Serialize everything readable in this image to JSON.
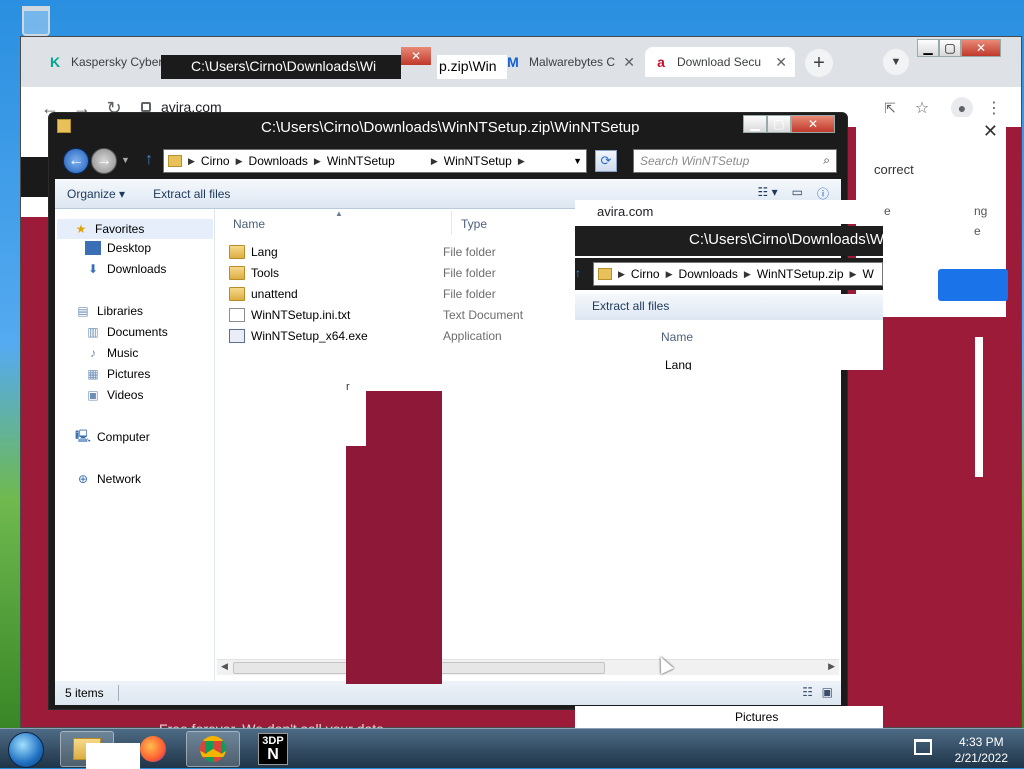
{
  "chrome": {
    "tabs": [
      {
        "title": "Kaspersky Cyber",
        "favicon": "K"
      },
      {
        "title": "Malwarebytes C",
        "favicon": "M"
      },
      {
        "title": "Download Secu",
        "favicon": "a"
      }
    ],
    "url": "avira.com",
    "page": {
      "correct_text": "correct",
      "side_text_1": "e",
      "side_text_2": "ng",
      "side_text_3": "e",
      "promo": "Free forever. We don't sell your data."
    }
  },
  "explorer": {
    "title": "C:\\Users\\Cirno\\Downloads\\WinNTSetup.zip\\WinNTSetup",
    "breadcrumbs": [
      "Cirno",
      "Downloads",
      "WinNTSetup",
      "WinNTSetup"
    ],
    "search_placeholder": "Search WinNTSetup",
    "commands": {
      "organize": "Organize",
      "extract": "Extract all files"
    },
    "nav": {
      "favorites": "Favorites",
      "desktop": "Desktop",
      "downloads": "Downloads",
      "libraries": "Libraries",
      "documents": "Documents",
      "music": "Music",
      "pictures": "Pictures",
      "videos": "Videos",
      "computer": "Computer",
      "network": "Network"
    },
    "columns": {
      "name": "Name",
      "type": "Type"
    },
    "files": [
      {
        "name": "Lang",
        "type": "File folder",
        "kind": "folder"
      },
      {
        "name": "Tools",
        "type": "File folder",
        "kind": "folder"
      },
      {
        "name": "unattend",
        "type": "File folder",
        "kind": "folder"
      },
      {
        "name": "WinNTSetup.ini.txt",
        "type": "Text Document",
        "kind": "txt"
      },
      {
        "name": "WinNTSetup_x64.exe",
        "type": "Application",
        "kind": "exe"
      }
    ],
    "status": "5 items"
  },
  "ghost": {
    "url": "avira.com",
    "title": "C:\\Users\\Cirno\\Downloads\\W",
    "breadcrumbs": [
      "Cirno",
      "Downloads",
      "WinNTSetup.zip",
      "W"
    ],
    "extract": "Extract all files",
    "name_col": "Name",
    "first_row": "Lang",
    "bottom_item": "Pictures"
  },
  "behind_window": {
    "title": "C:\\Users\\Cirno\\Downloads\\Wi",
    "fragment": "p.zip\\Win"
  },
  "taskbar": {
    "time": "4:33 PM",
    "date": "2/21/2022",
    "app_3dp_top": "3DP",
    "app_3dp_bottom": "N"
  },
  "colors": {
    "accent_maroon": "#8e1838",
    "avira_red": "#c8102e",
    "chrome_blue": "#1a73e8"
  }
}
